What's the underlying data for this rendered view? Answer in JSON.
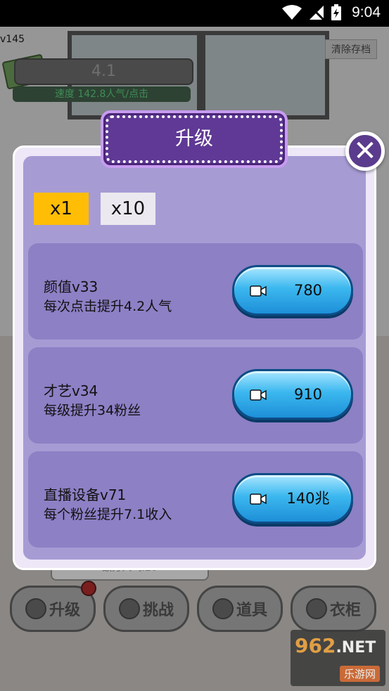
{
  "status_bar": {
    "time": "9:04"
  },
  "background": {
    "version": "v145",
    "score": "4.1",
    "speed": "速度 142.8人气/点击",
    "clear_save": "清除存档",
    "bubble_text": "敌方人气:20",
    "tabs": [
      {
        "label": "升级",
        "icon": "arrow-up-icon"
      },
      {
        "label": "挑战",
        "icon": "gear-icon"
      },
      {
        "label": "道具",
        "icon": "sofa-icon"
      },
      {
        "label": "衣柜",
        "icon": "wardrobe-icon"
      }
    ],
    "watermark_main": "962",
    "watermark_suffix": ".NET",
    "watermark_sub": "乐游网"
  },
  "dialog": {
    "title": "升级",
    "close_symbol": "✕",
    "multipliers": [
      {
        "label": "x1",
        "selected": true
      },
      {
        "label": "x10",
        "selected": false
      }
    ],
    "items": [
      {
        "name": "颜值v33",
        "desc": "每次点击提升4.2人气",
        "price": "780"
      },
      {
        "name": "才艺v34",
        "desc": "每级提升34粉丝",
        "price": "910"
      },
      {
        "name": "直播设备v71",
        "desc": "每个粉丝提升7.1收入",
        "price": "140兆"
      }
    ]
  },
  "colors": {
    "dialog_bg": "#a79bd4",
    "card_bg": "#8d80c5",
    "title_plate": "#5f3995",
    "selected_mult": "#ffbd05",
    "button_blue": "#3cb8ef"
  }
}
